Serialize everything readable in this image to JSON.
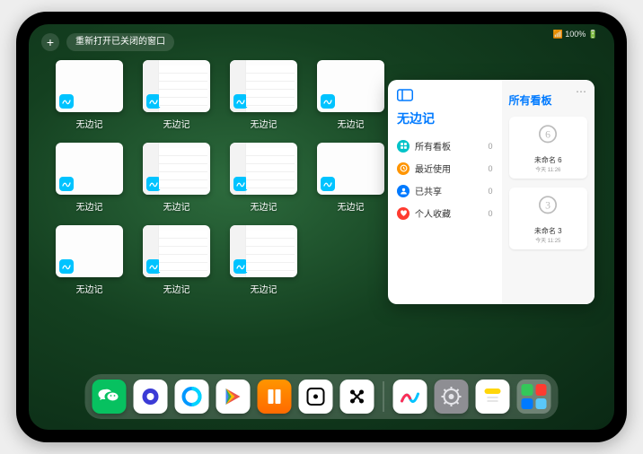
{
  "status": "📶 100% 🔋",
  "topbar": {
    "plus": "+",
    "reopen": "重新打开已关闭的窗口"
  },
  "app_label": "无边记",
  "panel": {
    "title": "无边记",
    "rows": [
      {
        "icon": "grid",
        "color": "#00c3c8",
        "label": "所有看板",
        "count": 0
      },
      {
        "icon": "clock",
        "color": "#ff9500",
        "label": "最近使用",
        "count": 0
      },
      {
        "icon": "person",
        "color": "#007aff",
        "label": "已共享",
        "count": 0
      },
      {
        "icon": "heart",
        "color": "#ff3b30",
        "label": "个人收藏",
        "count": 0
      }
    ],
    "right_title": "所有看板",
    "boards": [
      {
        "glyph": "6",
        "name": "未命名 6",
        "time": "今天 11:26"
      },
      {
        "glyph": "3",
        "name": "未命名 3",
        "time": "今天 11:25"
      }
    ]
  },
  "dock": [
    {
      "name": "wechat",
      "bg": "#07c160"
    },
    {
      "name": "quark",
      "bg": "#ffffff"
    },
    {
      "name": "qqbrowser",
      "bg": "#ffffff"
    },
    {
      "name": "play",
      "bg": "#ffffff"
    },
    {
      "name": "books",
      "bg": "linear-gradient(#ff9500,#ff6a00)"
    },
    {
      "name": "dice",
      "bg": "#ffffff"
    },
    {
      "name": "dots",
      "bg": "#ffffff"
    },
    {
      "name": "freeform",
      "bg": "#ffffff"
    },
    {
      "name": "settings",
      "bg": "#8e8e93"
    },
    {
      "name": "notes",
      "bg": "#ffffff"
    }
  ]
}
